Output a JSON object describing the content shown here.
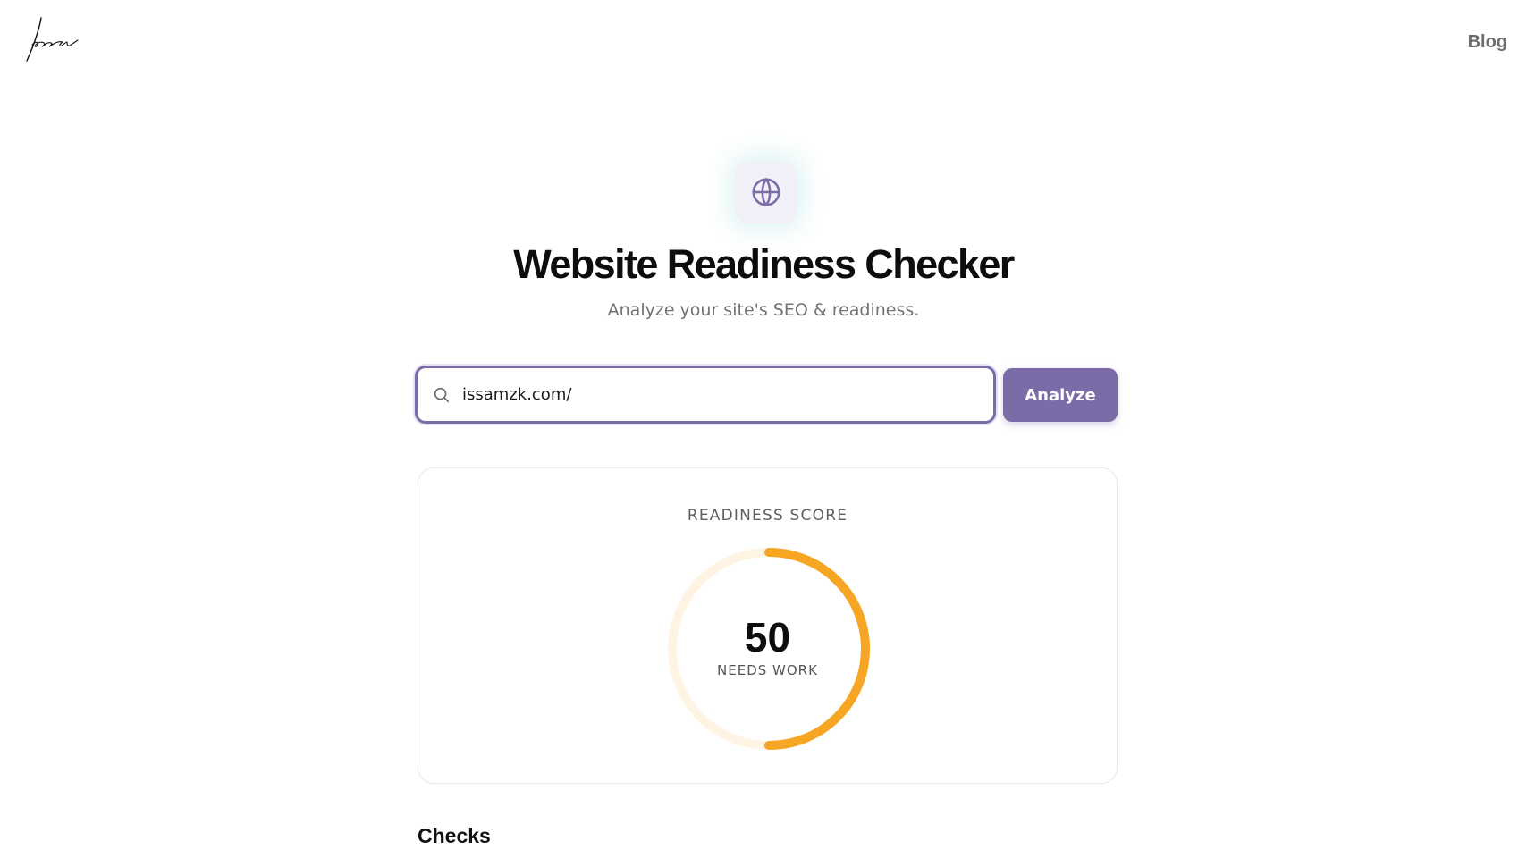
{
  "header": {
    "logo_text": "Issa",
    "logo_icon": "signature-logo",
    "nav": [
      {
        "label": "Blog"
      }
    ]
  },
  "hero": {
    "icon": "globe-icon",
    "title": "Website Readiness Checker",
    "subtitle": "Analyze your site's SEO & readiness."
  },
  "search": {
    "icon": "search-icon",
    "value": "issamzk.com/",
    "button_label": "Analyze"
  },
  "score": {
    "label": "READINESS SCORE",
    "value": "50",
    "max": 100,
    "status": "NEEDS WORK"
  },
  "checks": {
    "heading": "Checks"
  },
  "colors": {
    "accent": "#7b6ca8",
    "gauge_fill": "#f6a623",
    "gauge_track": "#fff4e3",
    "hero_icon_bg": "#f1eff7",
    "text_primary": "#0d0d0d",
    "text_muted": "#737373"
  }
}
